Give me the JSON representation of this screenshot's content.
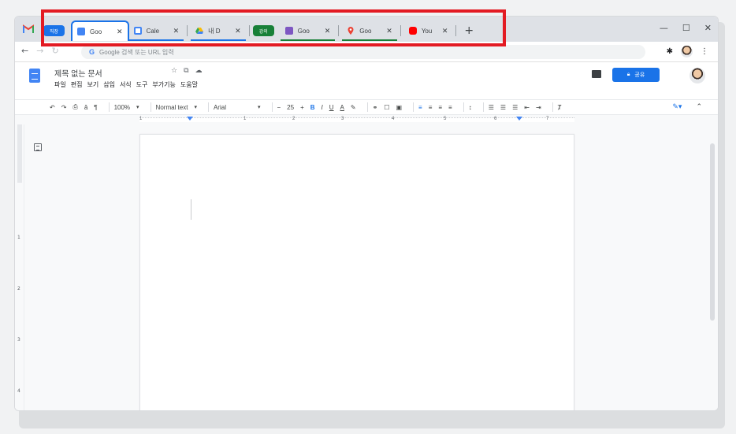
{
  "browser": {
    "tab_groups": [
      {
        "label": "직장",
        "color": "#1a73e8"
      },
      {
        "label": "강의",
        "color": "#188038"
      }
    ],
    "tabs": [
      {
        "title": "Goo",
        "favicon": "docs-icon",
        "active": true
      },
      {
        "title": "Cale",
        "favicon": "calendar-icon"
      },
      {
        "title": "내 D",
        "favicon": "drive-icon"
      },
      {
        "title": "Goo",
        "favicon": "forms-icon"
      },
      {
        "title": "Goo",
        "favicon": "maps-icon"
      },
      {
        "title": "You",
        "favicon": "youtube-icon"
      }
    ],
    "new_tab": "+",
    "close": "✕",
    "window_controls": {
      "minimize": "—",
      "maximize": "☐",
      "close": "✕"
    },
    "address_placeholder": "Google 검색 또는 URL 입력",
    "highlight_color": "#e31b23"
  },
  "docs": {
    "title": "제목 없는 문서",
    "menu": [
      "파일",
      "편집",
      "보기",
      "삽입",
      "서식",
      "도구",
      "부가기능",
      "도움말"
    ],
    "share_label": "공유",
    "toolbar": {
      "zoom": "100%",
      "style": "Normal text",
      "font": "Arial",
      "font_size": "25",
      "minus": "−",
      "plus": "+",
      "bold": "B",
      "italic": "I",
      "underline": "U",
      "text_color": "A"
    },
    "ruler_numbers": [
      "1",
      "1",
      "2",
      "3",
      "4",
      "5",
      "6",
      "7"
    ],
    "vertical_ruler_numbers": [
      "1",
      "2",
      "3",
      "4"
    ]
  }
}
